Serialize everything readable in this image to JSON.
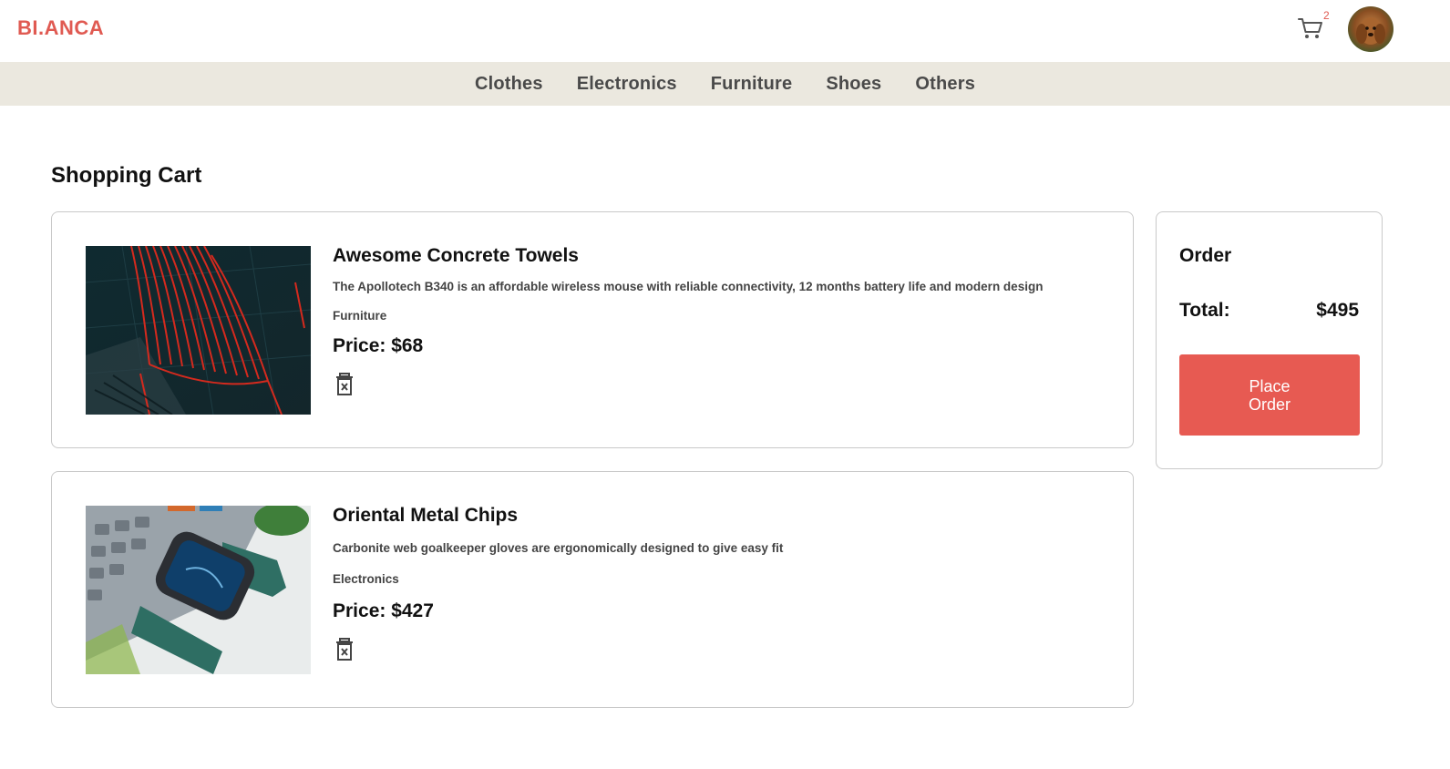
{
  "header": {
    "logo": "BI.ANCA",
    "cart_count": "2",
    "cart_icon": "cart-icon",
    "avatar_icon": "user-avatar"
  },
  "nav": {
    "categories": [
      "Clothes",
      "Electronics",
      "Furniture",
      "Shoes",
      "Others"
    ]
  },
  "page": {
    "title": "Shopping Cart"
  },
  "cart": {
    "items": [
      {
        "name": "Awesome Concrete Towels",
        "description": "The Apollotech B340 is an affordable wireless mouse with reliable connectivity, 12 months battery life and modern design",
        "category": "Furniture",
        "price": "Price: $68",
        "image": "red-wire-chair-photo"
      },
      {
        "name": "Oriental Metal Chips",
        "description": "Carbonite web goalkeeper gloves are ergonomically designed to give easy fit",
        "category": "Electronics",
        "price": "Price: $427",
        "image": "smartwatch-photo"
      }
    ]
  },
  "order": {
    "title": "Order",
    "total_label": "Total:",
    "total_value": "$495",
    "place_order_label": "Place Order"
  },
  "colors": {
    "brand": "#e05a52",
    "button": "#e75a52",
    "nav_bg": "#ebe8df"
  }
}
